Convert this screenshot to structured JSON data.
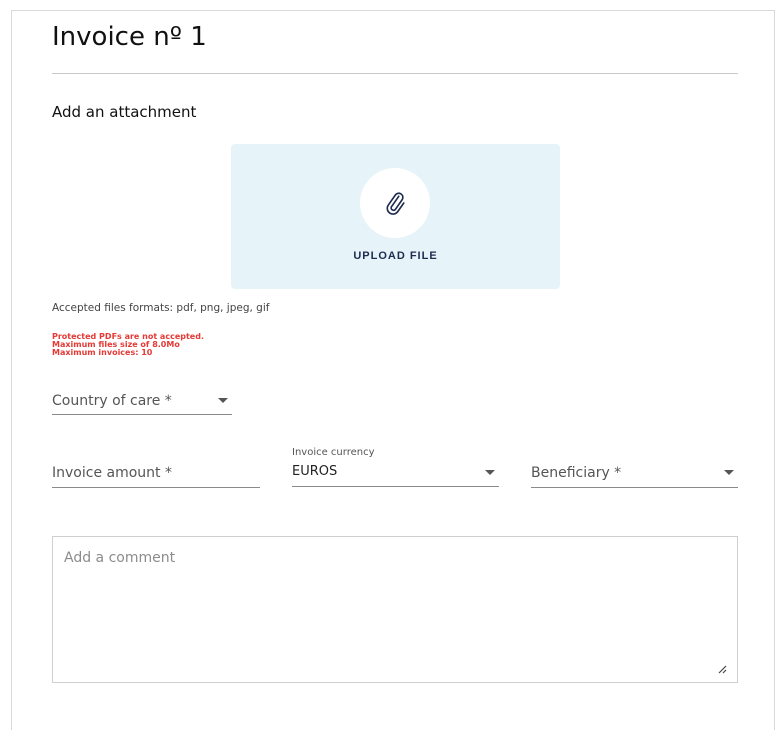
{
  "invoice": {
    "title": "Invoice nº 1"
  },
  "attachment": {
    "section_label": "Add an attachment",
    "upload_label": "UPLOAD FILE",
    "icon": "paperclip-icon",
    "accepted_formats": "Accepted files formats: pdf, png, jpeg, gif",
    "warnings": [
      "Protected PDFs are not accepted.",
      "Maximum files size of 8.0Mo",
      "Maximum invoices: 10"
    ]
  },
  "form": {
    "country_of_care": {
      "label": "Country of care *"
    },
    "invoice_amount": {
      "label": "Invoice amount *"
    },
    "invoice_currency": {
      "label": "Invoice currency",
      "value": "EUROS"
    },
    "beneficiary": {
      "label": "Beneficiary *"
    },
    "comment": {
      "placeholder": "Add a comment"
    }
  },
  "colors": {
    "upload_bg": "#e6f3f8",
    "warning": "#e53935",
    "upload_text": "#1d2b4f"
  }
}
